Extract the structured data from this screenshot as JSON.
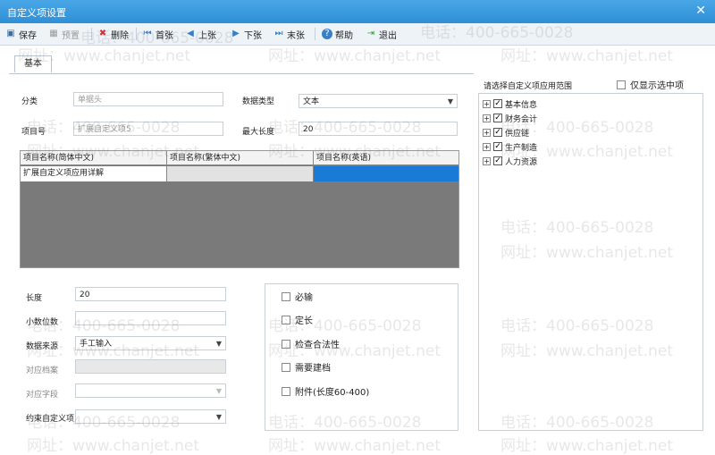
{
  "window": {
    "title": "自定义项设置",
    "close_symbol": "✕"
  },
  "toolbar": [
    {
      "label": "保存",
      "icon": "save-icon",
      "glyph": "▣",
      "enabled": true
    },
    {
      "label": "预置",
      "icon": "preset-icon",
      "glyph": "▦",
      "enabled": false
    },
    {
      "label": "删除",
      "icon": "delete-icon",
      "glyph": "✖",
      "enabled": true
    },
    {
      "label": "首张",
      "icon": "first-icon",
      "glyph": "⏮",
      "enabled": true
    },
    {
      "label": "上张",
      "icon": "prev-icon",
      "glyph": "◀",
      "enabled": true
    },
    {
      "label": "下张",
      "icon": "next-icon",
      "glyph": "▶",
      "enabled": true
    },
    {
      "label": "末张",
      "icon": "last-icon",
      "glyph": "⏭",
      "enabled": true
    },
    {
      "label": "帮助",
      "icon": "help-icon",
      "glyph": "?",
      "enabled": true
    },
    {
      "label": "退出",
      "icon": "exit-icon",
      "glyph": "⇥",
      "enabled": true
    }
  ],
  "tabs": {
    "basic": "基本"
  },
  "form": {
    "category_label": "分类",
    "category_value": "单据头",
    "datatype_label": "数据类型",
    "datatype_value": "文本",
    "item_no_label": "项目号",
    "item_no_value": "扩展自定义项5",
    "maxlen_label": "最大长度",
    "maxlen_value": "20"
  },
  "grid": {
    "headers": [
      "项目名称(简体中文)",
      "项目名称(繁体中文)",
      "项目名称(英语)"
    ],
    "row": [
      "扩展自定义项应用详解",
      "",
      ""
    ]
  },
  "lower_form": {
    "length_label": "长度",
    "length_value": "20",
    "decimals_label": "小数位数",
    "decimals_value": "",
    "source_label": "数据来源",
    "source_value": "手工输入",
    "archive_label": "对应档案",
    "archive_value": "",
    "field_label": "对应字段",
    "field_value": "",
    "constraint_label": "约束自定义项",
    "constraint_value": ""
  },
  "options": [
    "必输",
    "定长",
    "检查合法性",
    "需要建档",
    "附件(长度60-400)"
  ],
  "scope": {
    "label": "请选择自定义项应用范围",
    "only_selected": "仅显示选中项",
    "tree": [
      "基本信息",
      "财务会计",
      "供应链",
      "生产制造",
      "人力资源"
    ]
  },
  "watermark": {
    "phone": "电话：400-665-0028",
    "site": "网址：www.chanjet.net"
  }
}
